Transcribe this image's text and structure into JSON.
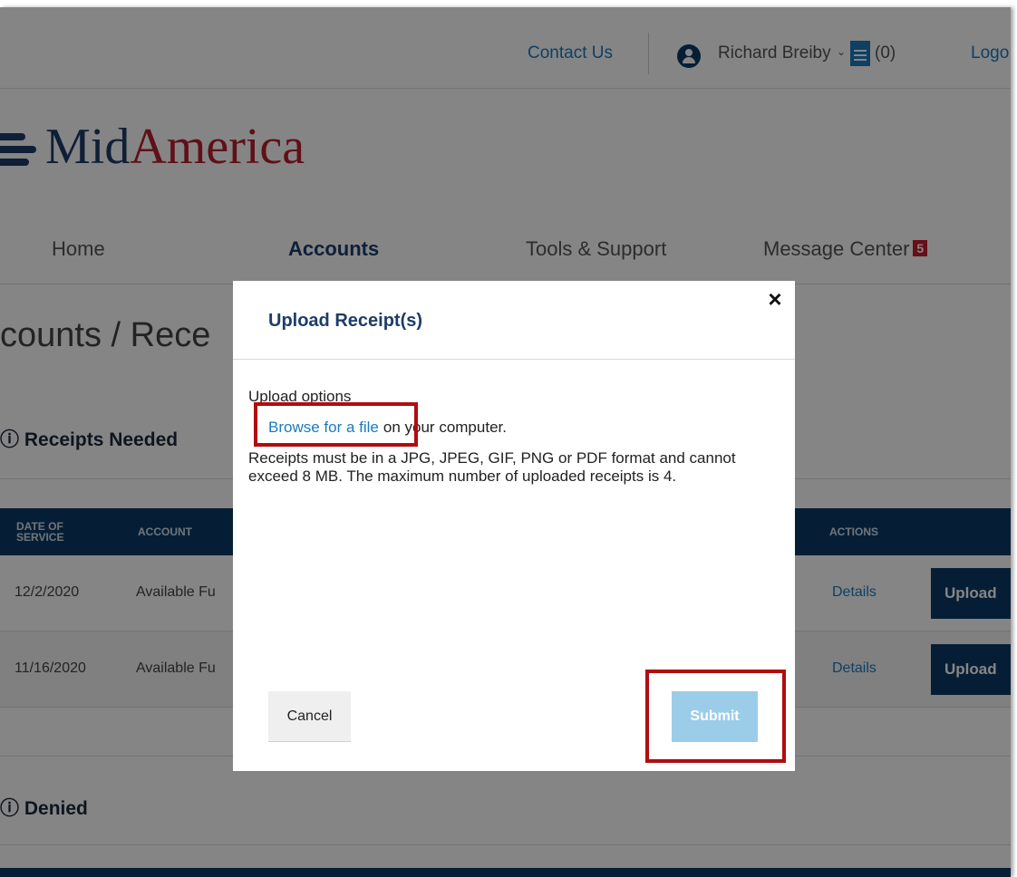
{
  "header": {
    "contact_label": "Contact Us",
    "user_name": "Richard Breiby",
    "cart_count": "(0)",
    "logout_label": "Logo"
  },
  "logo": {
    "mid": "Mid",
    "america": "America"
  },
  "nav": {
    "items": [
      "Home",
      "Accounts",
      "Tools & Support",
      "Message Center"
    ],
    "active": "Accounts",
    "message_badge": "5"
  },
  "page": {
    "title": "counts / Rece",
    "receipts_needed_heading": "Receipts Needed",
    "denied_heading": "Denied"
  },
  "table": {
    "headers": {
      "date": "DATE OF SERVICE",
      "account": "ACCOUNT",
      "actions": "ACTIONS"
    },
    "rows": [
      {
        "date": "12/2/2020",
        "account": "Available Fu",
        "details": "Details",
        "upload": "Upload"
      },
      {
        "date": "11/16/2020",
        "account": "Available Fu",
        "details": "Details",
        "upload": "Upload"
      }
    ]
  },
  "modal": {
    "title": "Upload Receipt(s)",
    "close": "×",
    "options_label": "Upload options",
    "browse_link": "Browse for a file",
    "browse_suffix": "on your computer.",
    "info": "Receipts must be in a JPG, JPEG, GIF, PNG or PDF format and cannot exceed 8 MB. The maximum number of uploaded receipts is 4.",
    "cancel_label": "Cancel",
    "submit_label": "Submit"
  },
  "colors": {
    "brand_navy": "#0d3b66",
    "brand_red": "#b8202e",
    "link_blue": "#1a7bbf",
    "submit_disabled": "#9ccde8",
    "highlight_box": "#b00d10"
  }
}
